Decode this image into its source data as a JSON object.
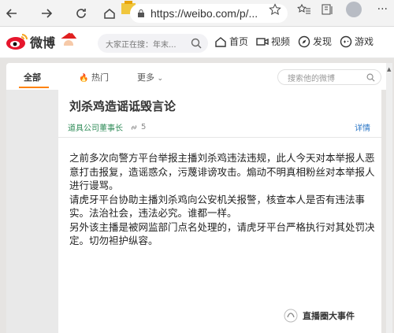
{
  "browser": {
    "url": "https://weibo.com/p/..."
  },
  "header": {
    "logo_text": "微博",
    "search_placeholder": "大家正在搜：年末...",
    "nav": [
      "首页",
      "视频",
      "发现",
      "游戏"
    ]
  },
  "tabs": {
    "all": "全部",
    "hot": "热门",
    "more": "更多",
    "search_placeholder": "搜索他的微博"
  },
  "post": {
    "title": "刘杀鸡造谣诋毁言论",
    "author": "道具公司董事长",
    "link_count": "5",
    "detail": "详情",
    "paragraphs": [
      "之前多次向警方平台举报主播刘杀鸡违法违规，此人今天对本举报人恶意打击报复，造谣惑众，污蔑诽谤攻击。煽动不明真相粉丝对本举报人进行谩骂。",
      "请虎牙平台协助主播刘杀鸡向公安机关报警，核查本人是否有违法事实。法治社会，违法必究。谁都一样。",
      "另外该主播是被网监部门点名处理的，请虎牙平台严格执行对其处罚决定。切勿袒护纵容。"
    ]
  },
  "watermark": "直播圈大事件",
  "colors": {
    "weibo_orange": "#ff8200",
    "author_green": "#2e8b57",
    "link_blue": "#2a76c6"
  }
}
